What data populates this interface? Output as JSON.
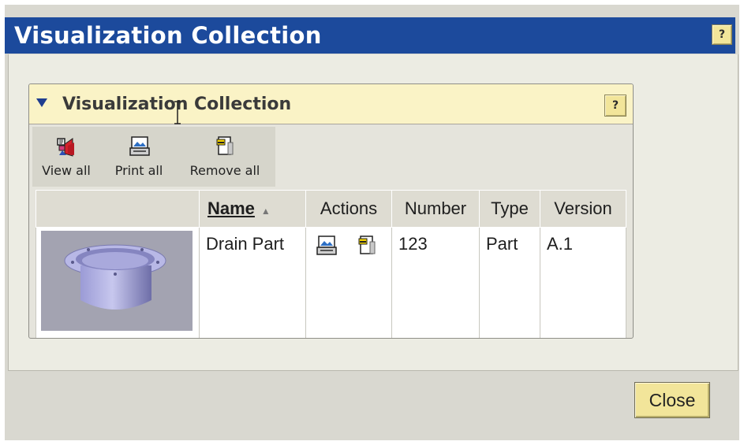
{
  "dialog": {
    "title": "Visualization Collection",
    "help_label": "?"
  },
  "section": {
    "title": "Visualization Collection",
    "help_label": "?"
  },
  "toolbar": {
    "view_all_label": "View all",
    "print_all_label": "Print all",
    "remove_all_label": "Remove all"
  },
  "table": {
    "columns": {
      "name": "Name",
      "actions": "Actions",
      "number": "Number",
      "type": "Type",
      "version": "Version"
    },
    "rows": [
      {
        "name": "Drain Part",
        "number": "123",
        "type": "Part",
        "version": "A.1"
      }
    ]
  },
  "footer": {
    "close_label": "Close"
  },
  "colors": {
    "title_bar": "#1c4a9c",
    "section_header": "#faf3c6",
    "button_face": "#f2e59a",
    "panel_bg": "#ecece3"
  },
  "icons": [
    "view-all-icon",
    "print-icon",
    "remove-icon",
    "sort-ascending-icon",
    "collapse-triangle-icon",
    "text-cursor-icon"
  ]
}
